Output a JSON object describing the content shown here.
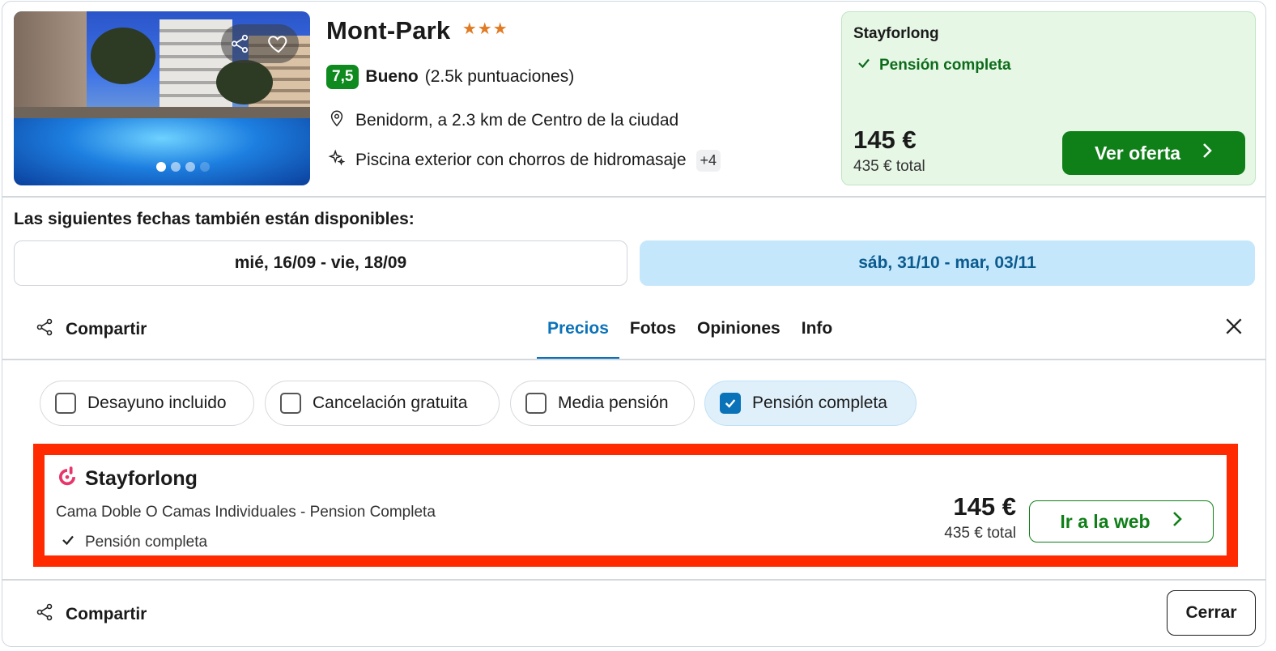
{
  "hotel": {
    "name": "Mont-Park",
    "stars": "★★★",
    "score": "7,5",
    "rating_word": "Bueno",
    "rating_count": "(2.5k puntuaciones)",
    "location": "Benidorm, a 2.3 km de Centro de la ciudad",
    "amenity": "Piscina exterior con chorros de hidromasaje",
    "amenity_more": "+4",
    "photo_count_dots": 4,
    "active_photo_index": 0
  },
  "deal": {
    "provider": "Stayforlong",
    "feature": "Pensión completa",
    "price": "145 €",
    "total": "435 € total",
    "button_label": "Ver oferta"
  },
  "dates": {
    "title": "Las siguientes fechas también están disponibles:",
    "options": [
      {
        "label": "mié, 16/09 - vie, 18/09",
        "selected": false
      },
      {
        "label": "sáb, 31/10 - mar, 03/11",
        "selected": true
      }
    ]
  },
  "toolbar": {
    "share_label": "Compartir",
    "tabs": [
      {
        "label": "Precios",
        "active": true
      },
      {
        "label": "Fotos",
        "active": false
      },
      {
        "label": "Opiniones",
        "active": false
      },
      {
        "label": "Info",
        "active": false
      }
    ]
  },
  "filters": [
    {
      "label": "Desayuno incluido",
      "checked": false
    },
    {
      "label": "Cancelación gratuita",
      "checked": false
    },
    {
      "label": "Media pensión",
      "checked": false
    },
    {
      "label": "Pensión completa",
      "checked": true
    }
  ],
  "offer": {
    "provider": "Stayforlong",
    "room": "Cama Doble O Camas Individuales - Pension Completa",
    "feature": "Pensión completa",
    "price": "145 €",
    "total": "435 € total",
    "button_label": "Ir a la web"
  },
  "footer": {
    "share_label": "Compartir",
    "close_label": "Cerrar"
  },
  "colors": {
    "brand_green": "#0f7f18",
    "score_green": "#0e8a1e",
    "accent_blue": "#0a72b8",
    "highlight_red": "#ff2a00",
    "stayforlong_pink": "#e8356b"
  }
}
